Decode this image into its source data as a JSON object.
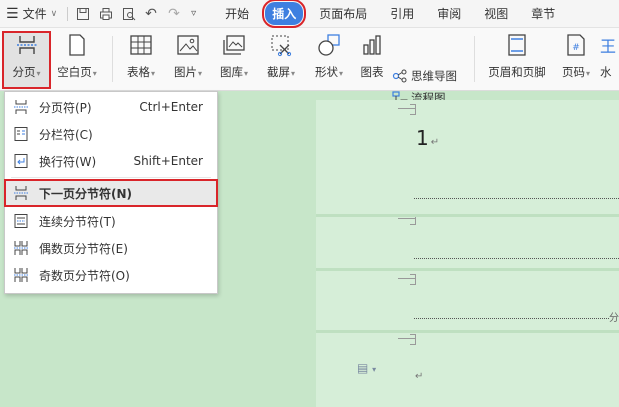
{
  "menubar": {
    "file_label": "文件",
    "tabs": [
      {
        "label": "开始",
        "active": false
      },
      {
        "label": "插入",
        "active": true
      },
      {
        "label": "页面布局",
        "active": false
      },
      {
        "label": "引用",
        "active": false
      },
      {
        "label": "审阅",
        "active": false
      },
      {
        "label": "视图",
        "active": false
      },
      {
        "label": "章节",
        "active": false
      }
    ]
  },
  "ribbon": {
    "page_break": "分页",
    "blank_page": "空白页",
    "table": "表格",
    "picture": "图片",
    "gallery": "图库",
    "screenshot": "截屏",
    "shape": "形状",
    "chart": "图表",
    "mindmap": "思维导图",
    "flowchart": "流程图",
    "header_footer": "页眉和页脚",
    "page_number": "页码",
    "watermark": "水"
  },
  "dropdown": {
    "items": [
      {
        "label": "分页符(P)",
        "shortcut": "Ctrl+Enter",
        "icon": "page-break-icon"
      },
      {
        "label": "分栏符(C)",
        "shortcut": "",
        "icon": "column-break-icon"
      },
      {
        "label": "换行符(W)",
        "shortcut": "Shift+Enter",
        "icon": "line-break-icon"
      },
      {
        "label": "下一页分节符(N)",
        "shortcut": "",
        "icon": "next-page-section-icon",
        "selected": true
      },
      {
        "label": "连续分节符(T)",
        "shortcut": "",
        "icon": "continuous-section-icon"
      },
      {
        "label": "偶数页分节符(E)",
        "shortcut": "",
        "icon": "even-page-section-icon"
      },
      {
        "label": "奇数页分节符(O)",
        "shortcut": "",
        "icon": "odd-page-section-icon"
      }
    ]
  },
  "document": {
    "page_number": "1",
    "return_mark": "↵",
    "edge_text": "分"
  },
  "colors": {
    "accent": "#3e7fe0",
    "highlight": "#d9252a",
    "doc_background": "#c7e6c9"
  }
}
